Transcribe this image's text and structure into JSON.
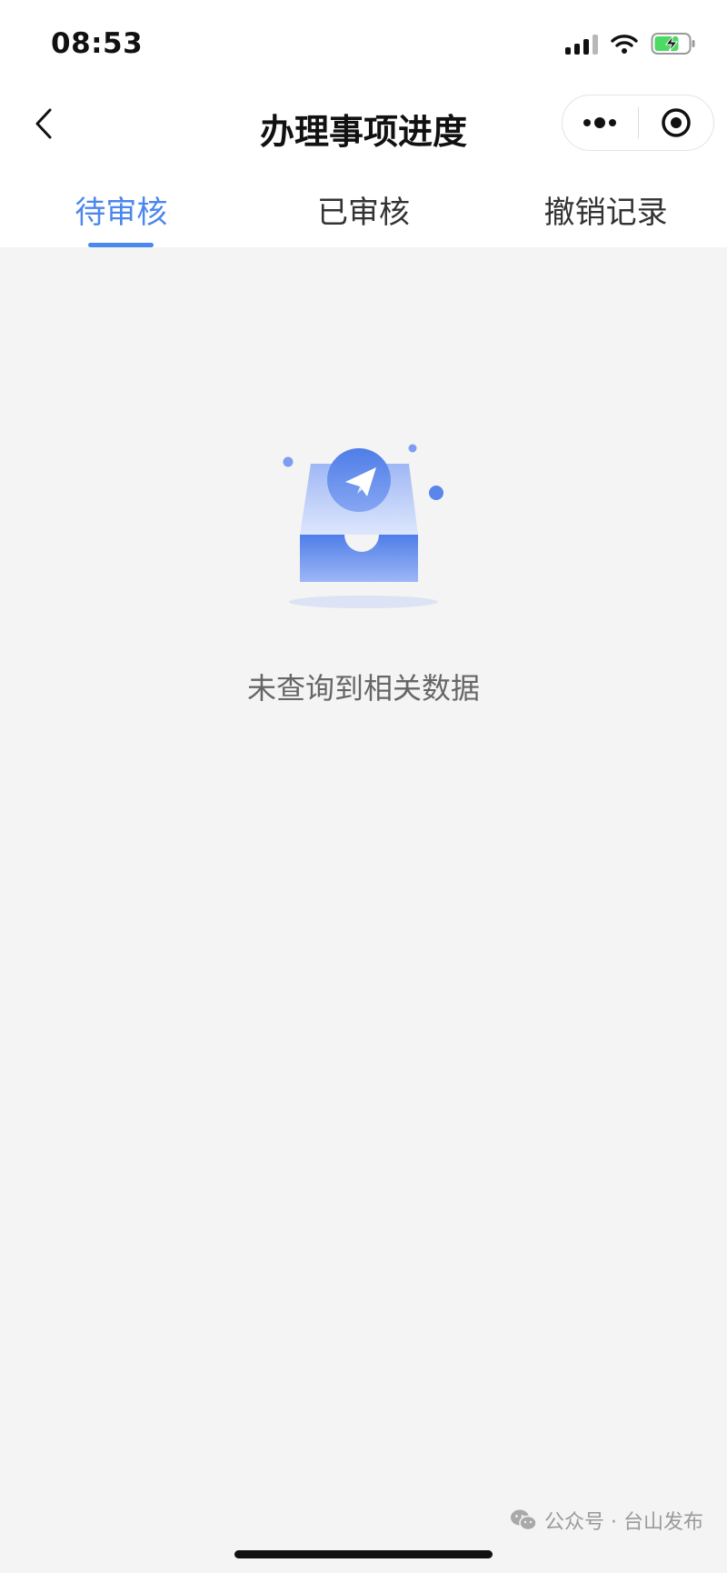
{
  "status_bar": {
    "time": "08:53"
  },
  "nav": {
    "title": "办理事项进度"
  },
  "tabs": [
    {
      "label": "待审核",
      "active": true
    },
    {
      "label": "已审核",
      "active": false
    },
    {
      "label": "撤销记录",
      "active": false
    }
  ],
  "empty_state": {
    "message": "未查询到相关数据",
    "icon": "empty-inbox-paper-plane-icon"
  },
  "watermark": {
    "text": "公众号 · 台山发布",
    "icon": "wechat-icon"
  },
  "colors": {
    "accent": "#4b87ee",
    "background": "#f4f4f4",
    "battery": "#4cd964"
  }
}
